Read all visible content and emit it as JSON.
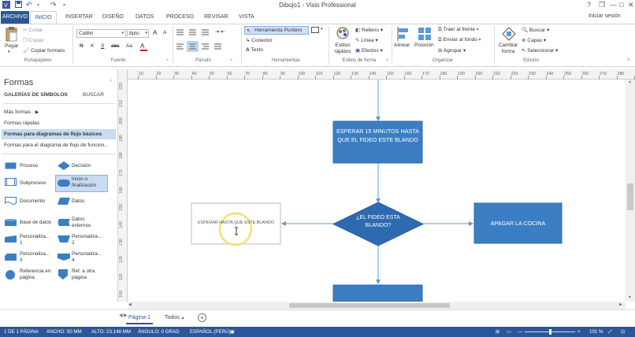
{
  "window": {
    "title": "Dibujo1 - Visio Professional"
  },
  "quick_access": {
    "app_icon": "visio-icon",
    "save_icon": "save-icon",
    "undo_icon": "undo-icon",
    "redo_icon": "redo-icon"
  },
  "window_controls": {
    "help": "?",
    "restore": "❐",
    "minimize": "—",
    "maximize": "□",
    "close": "✕"
  },
  "tabs": [
    {
      "label": "ARCHIVO"
    },
    {
      "label": "INICIO"
    },
    {
      "label": "INSERTAR"
    },
    {
      "label": "DISEÑO"
    },
    {
      "label": "DATOS"
    },
    {
      "label": "PROCESO"
    },
    {
      "label": "REVISAR"
    },
    {
      "label": "VISTA"
    }
  ],
  "sign_in": "Iniciar sesión",
  "ribbon": {
    "portapapeles": {
      "label": "Portapapeles",
      "pegar": "Pegar",
      "cortar": "Cortar",
      "copiar": "Copiar",
      "copiar_formato": "Copiar formato"
    },
    "fuente": {
      "label": "Fuente",
      "font": "Calibri",
      "size": "8pto.",
      "bold": "N",
      "italic": "K",
      "underline": "S",
      "strike": "abc",
      "aa": "Aa",
      "grow": "A",
      "shrink": "A"
    },
    "parrafo": {
      "label": "Párrafo"
    },
    "herramientas": {
      "label": "Herramientas",
      "puntero": "Herramienta Puntero",
      "conector": "Conector",
      "texto": "Texto"
    },
    "estilos": {
      "label": "Estilos de forma",
      "estilos_rapidos": "Estilos rápidos",
      "relleno": "Relleno",
      "linea": "Línea",
      "efectos": "Efectos"
    },
    "organizar": {
      "label": "Organizar",
      "alinear": "Alinear",
      "posicion": "Posición",
      "traer": "Traer al frente",
      "enviar": "Enviar al fondo",
      "agrupar": "Agrupar"
    },
    "edicion": {
      "label": "Edición",
      "cambiar": "Cambiar forma",
      "buscar": "Buscar",
      "capas": "Capas",
      "seleccionar": "Seleccionar"
    }
  },
  "pane": {
    "title": "Formas",
    "tab_galerias": "GALERÍAS DE SÍMBOLOS",
    "tab_buscar": "BUSCAR",
    "mas_formas": "Más formas",
    "stencils": [
      {
        "label": "Formas rápidas"
      },
      {
        "label": "Formas para diagramas de flujo básicos"
      },
      {
        "label": "Formas para el diagrama de flujo de funcion..."
      }
    ],
    "shapes": [
      {
        "label": "Proceso"
      },
      {
        "label": "Decisión"
      },
      {
        "label": "Subproceso"
      },
      {
        "label": "Inicio o finalización"
      },
      {
        "label": "Documento"
      },
      {
        "label": "Datos"
      },
      {
        "label": "Base de datos"
      },
      {
        "label": "Datos externos"
      },
      {
        "label": "Personaliza... 1"
      },
      {
        "label": "Personaliza... 2"
      },
      {
        "label": "Personaliza... 3"
      },
      {
        "label": "Personaliza... 4"
      },
      {
        "label": "Referencia en página"
      },
      {
        "label": "Ref. a otra página"
      }
    ]
  },
  "rulers": {
    "h": [
      "10",
      "20",
      "30",
      "40",
      "50",
      "60",
      "70",
      "80",
      "90",
      "100",
      "110",
      "120",
      "130",
      "140",
      "150",
      "160",
      "170",
      "180",
      "190",
      "200",
      "210",
      "220",
      "230",
      "240",
      "250",
      "260",
      "270",
      "280",
      "290",
      "300"
    ],
    "v": [
      "220",
      "210",
      "200",
      "190",
      "180",
      "170",
      "160",
      "150",
      "140",
      "130",
      "120",
      "110",
      "100",
      "90"
    ]
  },
  "diagram": {
    "process_top": "ESPERAR 15 MINUTOS HASTA QUE EL FIDEO ESTE BLANDO",
    "decision": "¿EL FIDEO ESTA BLANDO?",
    "process_right": "APAGAR LA COCINA",
    "editing_text": "ESPERAR HASTA QUE ESTE BLANDO",
    "shape_color": "#3b7ec4",
    "connector_color": "#5b9bd5"
  },
  "page_tabs": {
    "page": "Página-1",
    "all": "Todos",
    "add": "+"
  },
  "status": {
    "page": "1 DE 1 PÁGINA",
    "width": "ANCHO: 50 MM",
    "height": "ALTO: 23.148 MM",
    "angle": "ÁNGULO: 0 GRAD",
    "language": "ESPAÑOL (PERÚ)",
    "zoom": "101 %"
  }
}
